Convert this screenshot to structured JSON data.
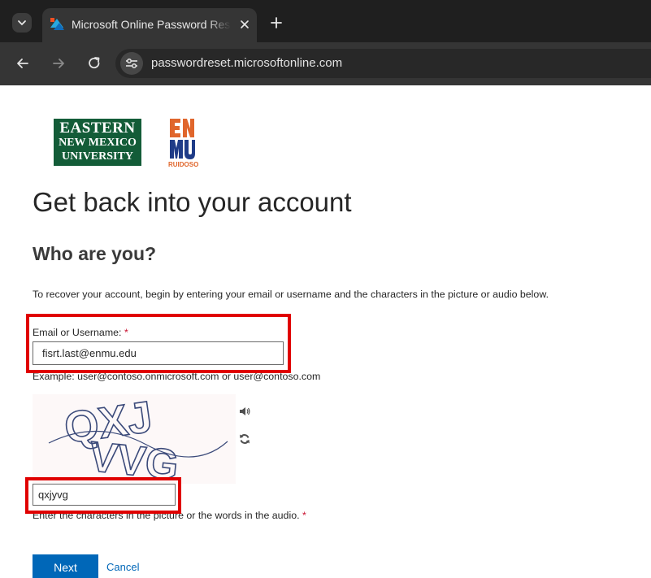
{
  "browser": {
    "tab": {
      "title": "Microsoft Online Password Reset"
    },
    "address_bar": {
      "url": "passwordreset.microsoftonline.com"
    }
  },
  "logos": {
    "enu": {
      "line1": "EASTERN",
      "line2": "NEW MEXICO",
      "line3": "UNIVERSITY"
    },
    "enmu": {
      "letters": "ENMU",
      "sub": "RUIDOSO"
    }
  },
  "page": {
    "title": "Get back into your account",
    "section_title": "Who are you?",
    "instructions": "To recover your account, begin by entering your email or username and the characters in the picture or audio below."
  },
  "email_field": {
    "label": "Email or Username:",
    "required_marker": "*",
    "value": "fisrt.last@enmu.edu",
    "example": "Example: user@contoso.onmicrosoft.com or user@contoso.com"
  },
  "captcha": {
    "image_text": "QXJ VVG",
    "input_value": "qxjyvg",
    "hint": "Enter the characters in the picture or the words in the audio.",
    "required_marker": "*"
  },
  "actions": {
    "next_label": "Next",
    "cancel_label": "Cancel"
  },
  "colors": {
    "accent": "#0067b8",
    "highlight": "#e00000",
    "required": "#c8102e",
    "enu_green": "#135c38",
    "enmu_blue": "#1f3c88",
    "enmu_orange": "#e0662c"
  },
  "icons": {
    "tab_list": "chevron-down-icon",
    "favicon": "microsoft-favicon-icon",
    "tab_close": "close-icon",
    "new_tab": "plus-icon",
    "back": "arrow-left-icon",
    "forward": "arrow-right-icon",
    "reload": "reload-icon",
    "site_info": "tune-icon",
    "audio": "speaker-icon",
    "refresh": "refresh-icon"
  }
}
